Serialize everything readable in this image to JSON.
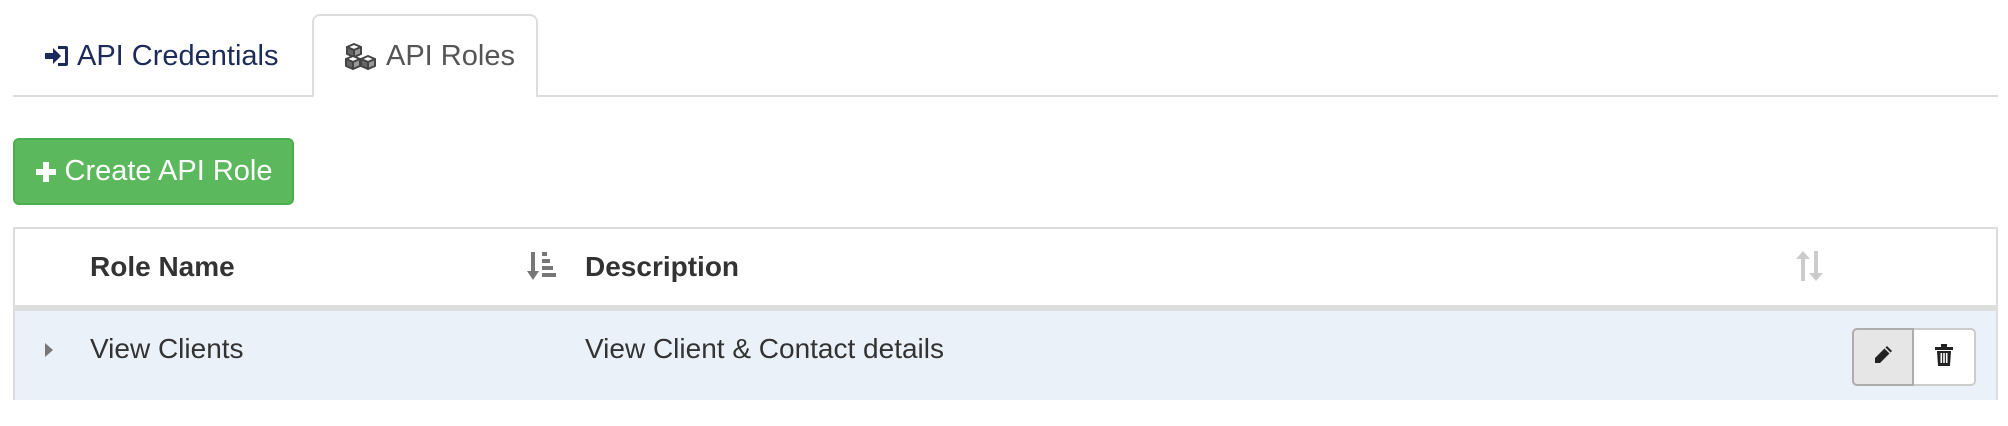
{
  "tabs": [
    {
      "label": "API Credentials",
      "icon": "sign-in-icon",
      "active": false
    },
    {
      "label": "API Roles",
      "icon": "cubes-icon",
      "active": true
    }
  ],
  "actions": {
    "create_label": "Create API Role",
    "create_icon": "plus-icon",
    "create_color": "#5cb85c"
  },
  "table": {
    "columns": [
      {
        "label": "Role Name",
        "sort_icon": "sort-amount-asc-icon"
      },
      {
        "label": "Description",
        "sort_icon": "sort-icon"
      }
    ],
    "rows": [
      {
        "role_name": "View Clients",
        "description": "View Client & Contact details",
        "actions": [
          "pencil-icon",
          "trash-icon"
        ]
      }
    ],
    "row_highlight_color": "#eaf1f8"
  },
  "colors": {
    "tab_link": "#1c2b5a",
    "border": "#dddddd",
    "success": "#5cb85c"
  }
}
